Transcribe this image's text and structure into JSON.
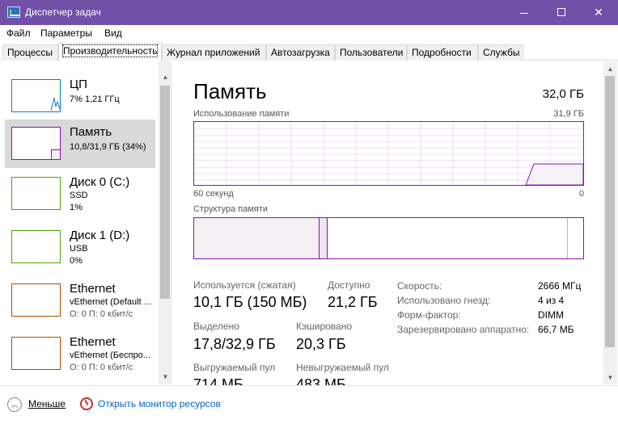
{
  "window": {
    "title": "Диспетчер задач"
  },
  "menu": [
    "Файл",
    "Параметры",
    "Вид"
  ],
  "tabs": [
    "Процессы",
    "Производительность",
    "Журнал приложений",
    "Автозагрузка",
    "Пользователи",
    "Подробности",
    "Службы"
  ],
  "active_tab": "Производительность",
  "sidebar": {
    "items": [
      {
        "name": "ЦП",
        "line1": "7% 1,21 ГГц",
        "color": "#117dbb"
      },
      {
        "name": "Память",
        "line1": "10,8/31,9 ГБ (34%)",
        "color": "#8b12ae",
        "selected": true
      },
      {
        "name": "Диск 0 (C:)",
        "line1": "SSD",
        "line2": "1%",
        "color": "#4da60c"
      },
      {
        "name": "Диск 1 (D:)",
        "line1": "USB",
        "line2": "0%",
        "color": "#4da60c"
      },
      {
        "name": "Ethernet",
        "line1": "vEthernet (Default ...",
        "line2": "О: 0 П: 0 кбит/с",
        "color": "#a74f01"
      },
      {
        "name": "Ethernet",
        "line1": "vEthernet (Беспро...",
        "line2": "О: 0 П: 0 кбит/с",
        "color": "#a74f01"
      }
    ]
  },
  "main": {
    "title": "Память",
    "total": "32,0 ГБ",
    "usage_label": "Использование памяти",
    "usage_max": "31,9 ГБ",
    "x_left": "60 секунд",
    "x_right": "0",
    "struct_label": "Структура памяти",
    "stats": {
      "in_use_label": "Используется (сжатая)",
      "in_use": "10,1 ГБ (150 МБ)",
      "available_label": "Доступно",
      "available": "21,2 ГБ",
      "committed_label": "Выделено",
      "committed": "17,8/32,9 ГБ",
      "cached_label": "Кэшировано",
      "cached": "20,3 ГБ",
      "paged_label": "Выгружаемый пул",
      "paged": "714 МБ",
      "nonpaged_label": "Невыгружаемый пул",
      "nonpaged": "483 МБ"
    },
    "specs": [
      {
        "label": "Скорость:",
        "value": "2666 МГц"
      },
      {
        "label": "Использовано гнезд:",
        "value": "4 из 4"
      },
      {
        "label": "Форм-фактор:",
        "value": "DIMM"
      },
      {
        "label": "Зарезервировано аппаратно:",
        "value": "66,7 МБ"
      }
    ]
  },
  "footer": {
    "fewer": "Меньше",
    "resmon": "Открыть монитор ресурсов"
  },
  "colors": {
    "titlebar": "#7150a8",
    "memory": "#8b12ae",
    "link": "#0066cc"
  }
}
